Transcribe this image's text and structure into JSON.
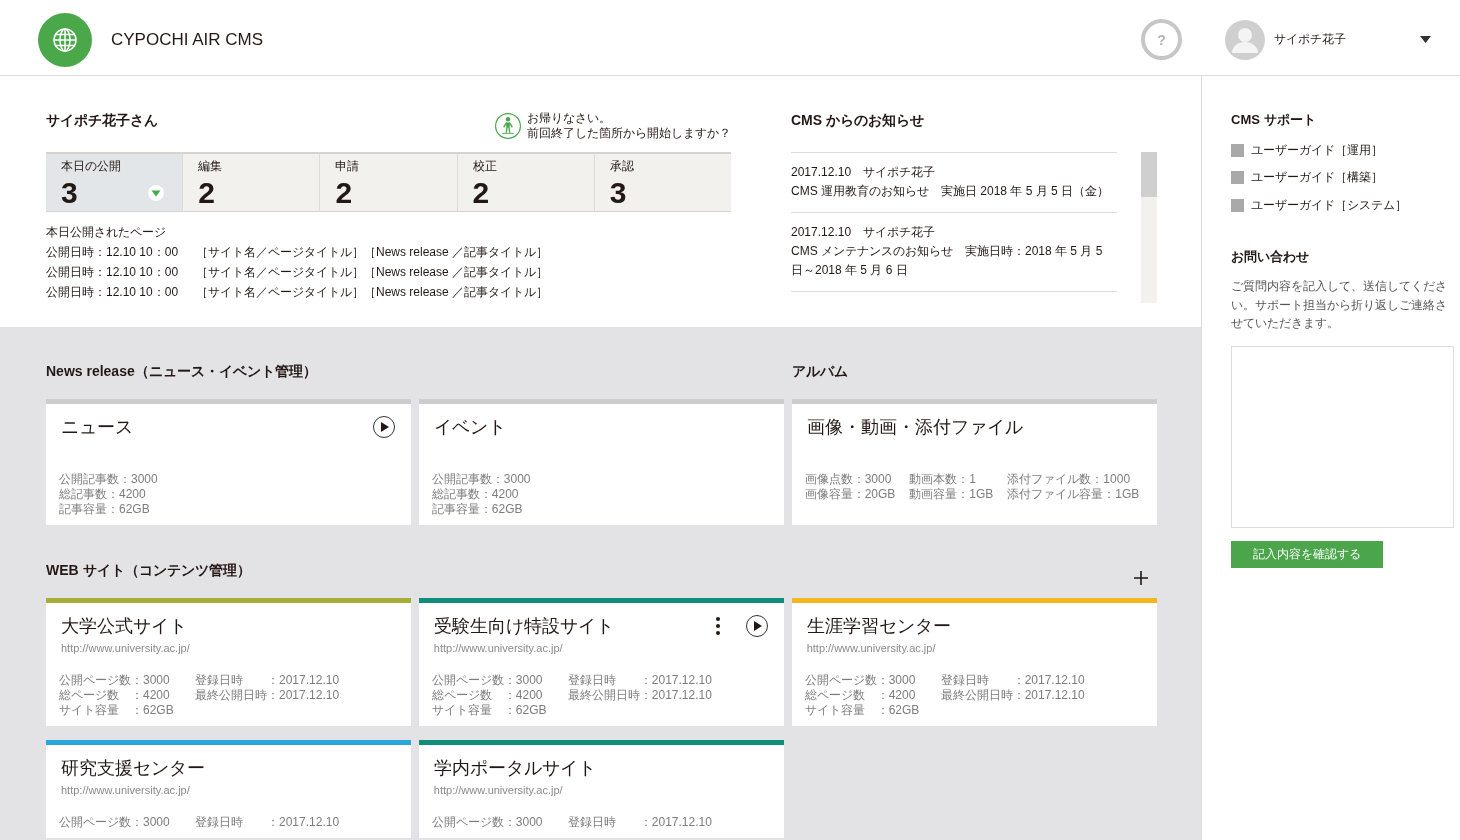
{
  "header": {
    "title": "CYPOCHI AIR CMS",
    "help_label": "?",
    "user_name": "サイポチ花子"
  },
  "greeting": {
    "title": "サイポチ花子さん",
    "resume_lines": [
      "お帰りなさい。",
      "前回終了した箇所から開始しますか？"
    ]
  },
  "status_tabs": [
    {
      "label": "本日の公開",
      "count": "3",
      "selected": true
    },
    {
      "label": "編集",
      "count": "2",
      "selected": false
    },
    {
      "label": "申請",
      "count": "2",
      "selected": false
    },
    {
      "label": "校正",
      "count": "2",
      "selected": false
    },
    {
      "label": "承認",
      "count": "3",
      "selected": false
    }
  ],
  "published_today": {
    "title": "本日公開されたページ",
    "rows": [
      {
        "time": "公開日時：12.10 10：00",
        "page": "［サイト名／ページタイトル］［News release ／記事タイトル］"
      },
      {
        "time": "公開日時：12.10 10：00",
        "page": "［サイト名／ページタイトル］［News release ／記事タイトル］"
      },
      {
        "time": "公開日時：12.10 10：00",
        "page": "［サイト名／ページタイトル］［News release ／記事タイトル］"
      }
    ]
  },
  "notices": {
    "title": "CMS からのお知らせ",
    "items": [
      {
        "meta": "2017.12.10　サイポチ花子",
        "text": "CMS 運用教育のお知らせ　実施日 2018 年 5 月 5 日（金）"
      },
      {
        "meta": "2017.12.10　サイポチ花子",
        "text": "CMS メンテナンスのお知らせ　実施日時：2018 年 5 月 5 日～2018 年 5 月 6 日"
      }
    ]
  },
  "news_release": {
    "title": "News release（ニュース・イベント管理）",
    "cards": [
      {
        "title": "ニュース",
        "play_button": true,
        "stats": [
          [
            "公開記事数：3000",
            "総記事数：4200",
            "記事容量：62GB"
          ]
        ]
      },
      {
        "title": "イベント",
        "play_button": false,
        "stats": [
          [
            "公開記事数：3000",
            "総記事数：4200",
            "記事容量：62GB"
          ]
        ]
      }
    ]
  },
  "album": {
    "title": "アルバム",
    "cards": [
      {
        "title": "画像・動画・添付ファイル",
        "play_button": false,
        "stats": [
          [
            "画像点数：3000",
            "画像容量：20GB"
          ],
          [
            "動画本数：1",
            "動画容量：1GB"
          ],
          [
            "添付ファイル数：1000",
            "添付ファイル容量：1GB"
          ]
        ]
      }
    ]
  },
  "web_sites": {
    "title": "WEB サイト（コンテンツ管理）",
    "cards": [
      {
        "title": "大学公式サイト",
        "url": "http://www.university.ac.jp/",
        "color": "#a5ae37",
        "menu_button": false,
        "play_button": false,
        "stats": [
          [
            "公開ページ数：3000",
            "総ページ数　：4200",
            "サイト容量　：62GB"
          ],
          [
            "登録日時　　：2017.12.10",
            "最終公開日時：2017.12.10"
          ]
        ]
      },
      {
        "title": "受験生向け特設サイト",
        "url": "http://www.university.ac.jp/",
        "color": "#0f8d7b",
        "menu_button": true,
        "play_button": true,
        "stats": [
          [
            "公開ページ数：3000",
            "総ページ数　：4200",
            "サイト容量　：62GB"
          ],
          [
            "登録日時　　：2017.12.10",
            "最終公開日時：2017.12.10"
          ]
        ]
      },
      {
        "title": "生涯学習センター",
        "url": "http://www.university.ac.jp/",
        "color": "#f2b61e",
        "menu_button": false,
        "play_button": false,
        "stats": [
          [
            "公開ページ数：3000",
            "総ページ数　：4200",
            "サイト容量　：62GB"
          ],
          [
            "登録日時　　：2017.12.10",
            "最終公開日時：2017.12.10"
          ]
        ]
      },
      {
        "title": "研究支援センター",
        "url": "http://www.university.ac.jp/",
        "color": "#2aa6df",
        "menu_button": false,
        "play_button": false,
        "stats": [
          [
            "公開ページ数：3000"
          ],
          [
            "登録日時　　：2017.12.10"
          ]
        ]
      },
      {
        "title": "学内ポータルサイト",
        "url": "http://www.university.ac.jp/",
        "color": "#0f8d7b",
        "menu_button": false,
        "play_button": false,
        "stats": [
          [
            "公開ページ数：3000"
          ],
          [
            "登録日時　　：2017.12.10"
          ]
        ]
      }
    ]
  },
  "sidebar": {
    "support": {
      "title": "CMS サポート",
      "links": [
        "ユーザーガイド［運用］",
        "ユーザーガイド［構築］",
        "ユーザーガイド［システム］"
      ]
    },
    "inquiry": {
      "title": "お問い合わせ",
      "description": "ご質問内容を記入して、送信してください。サポート担当から折り返しご連絡させていただきます。",
      "button": "記入内容を確認する"
    }
  }
}
